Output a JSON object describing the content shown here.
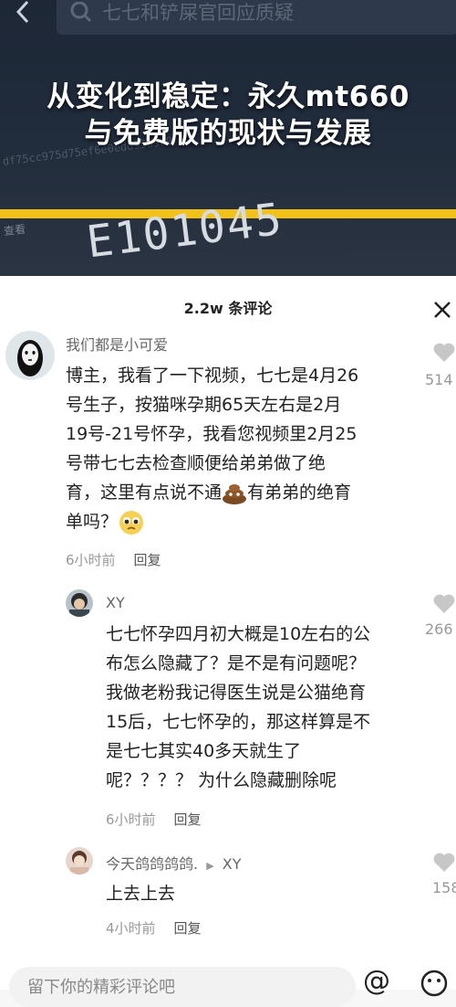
{
  "search": {
    "text": "七七和铲屎官回应质疑"
  },
  "headline": {
    "line1": "从变化到稳定：永久mt660",
    "line2": "与免费版的现状与发展"
  },
  "background": {
    "hash": "df75cc975d75ef6e0edd9569a9",
    "view_label": "查看",
    "number": "E101045"
  },
  "comments_panel": {
    "title": "2.2w 条评论",
    "comments": [
      {
        "username": "我们都是小可爱",
        "lines": [
          "博主，我看了一下视频，七七是4月26",
          "号生子，按猫咪孕期65天左右是2月",
          "19号-21号怀孕，我看您视频里2月25",
          "号带七七去检查顺便给弟弟做了绝"
        ],
        "line5a": "育，这里有点说不通",
        "line5b": "有弟弟的绝育",
        "line6": "单吗？",
        "time": "6小时前",
        "reply": "回复",
        "likes": "514"
      },
      {
        "username": "XY",
        "lines": [
          "七七怀孕四月初大概是10左右的公",
          "布怎么隐藏了？是不是有问题呢？",
          "我做老粉我记得医生说是公猫绝育",
          "15后，七七怀孕的，那这样算是不",
          "是七七其实40多天就生了",
          "呢？？？？ 为什么隐藏删除呢"
        ],
        "time": "6小时前",
        "reply": "回复",
        "likes": "266"
      },
      {
        "username": "今天鸽鸽鸽鸽.",
        "reply_to": "XY",
        "lines": [
          "上去上去"
        ],
        "time": "4小时前",
        "reply": "回复",
        "likes": "158"
      }
    ]
  },
  "input": {
    "placeholder": "留下你的精彩评论吧"
  },
  "colors": {
    "accent_yellow": "#f2c21b",
    "dark_bg": "#1d2736"
  }
}
